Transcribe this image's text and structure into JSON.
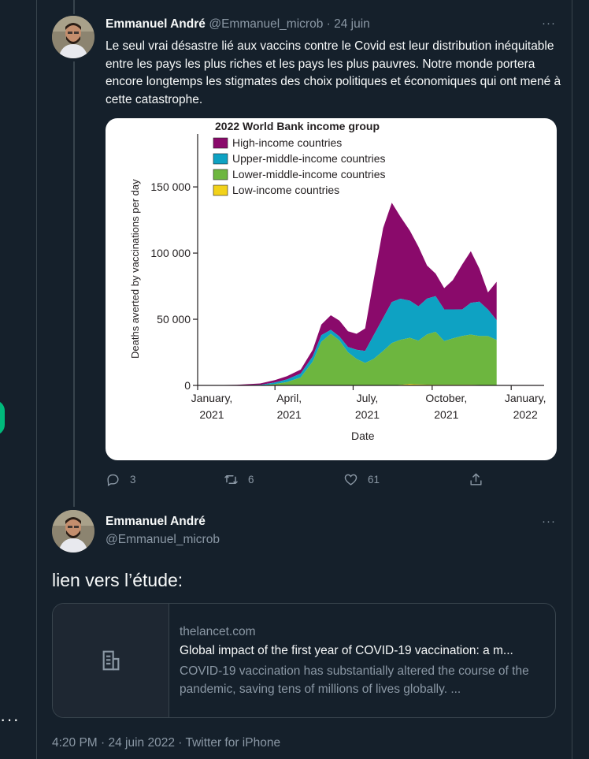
{
  "tweet1": {
    "author_name": "Emmanuel André",
    "author_handle": "@Emmanuel_microb",
    "date": "24 juin",
    "meta_separator": " · ",
    "text": "Le seul vrai désastre lié aux vaccins contre le Covid est leur distribution inéquitable entre les pays les plus riches et les pays les plus pauvres. Notre monde portera encore longtemps les stigmates des choix politiques et économiques qui ont mené à cette catastrophe.",
    "replies": "3",
    "retweets": "6",
    "likes": "61"
  },
  "chart_data": {
    "type": "area",
    "stacked": true,
    "legend_title": "2022 World Bank income group",
    "legend_position": "top-left",
    "xlabel": "Date",
    "ylabel": "Deaths averted by vaccinations per day",
    "x_ticks": [
      "January,\n2021",
      "April,\n2021",
      "July,\n2021",
      "October,\n2021",
      "January,\n2022"
    ],
    "y_ticks": [
      "0",
      "50 000",
      "100 000",
      "150 000"
    ],
    "ylim": [
      0,
      190000
    ],
    "x": [
      "2021-01-01",
      "2021-02-15",
      "2021-03-15",
      "2021-04-01",
      "2021-04-15",
      "2021-05-01",
      "2021-05-15",
      "2021-05-25",
      "2021-06-05",
      "2021-06-15",
      "2021-06-25",
      "2021-07-05",
      "2021-07-15",
      "2021-07-25",
      "2021-08-05",
      "2021-08-15",
      "2021-08-25",
      "2021-09-05",
      "2021-09-15",
      "2021-09-25",
      "2021-10-05",
      "2021-10-15",
      "2021-10-25",
      "2021-11-05",
      "2021-11-15",
      "2021-11-25",
      "2021-12-05",
      "2021-12-15"
    ],
    "series": [
      {
        "name": "Low-income countries",
        "color": "#f2d21a",
        "values": [
          0,
          0,
          0,
          0,
          0,
          0,
          0,
          0,
          0,
          0,
          0,
          0,
          0,
          0,
          0,
          0,
          500,
          1000,
          800,
          600,
          500,
          500,
          500,
          400,
          400,
          300,
          300,
          300
        ]
      },
      {
        "name": "Lower-middle-income countries",
        "color": "#6db63f",
        "values": [
          0,
          0,
          0,
          1000,
          2500,
          6000,
          18000,
          33000,
          39000,
          34000,
          25000,
          20000,
          17000,
          20000,
          26000,
          32000,
          34000,
          35000,
          33000,
          38000,
          40000,
          33000,
          35000,
          37000,
          38000,
          37000,
          37000,
          34000
        ]
      },
      {
        "name": "Upper-middle-income countries",
        "color": "#0ea2c3",
        "values": [
          0,
          100,
          500,
          1200,
          2000,
          3000,
          4000,
          5000,
          3000,
          3000,
          4000,
          7000,
          9000,
          18000,
          25000,
          31000,
          31000,
          28000,
          26000,
          27000,
          27000,
          24000,
          22000,
          20000,
          24000,
          26000,
          20000,
          15000
        ]
      },
      {
        "name": "High-income countries",
        "color": "#8a0a6b",
        "values": [
          0,
          300,
          1000,
          1800,
          2500,
          3000,
          5000,
          8000,
          11000,
          12000,
          12000,
          12000,
          17000,
          42000,
          68000,
          75000,
          62000,
          53000,
          45000,
          25000,
          17000,
          16000,
          22000,
          34000,
          39000,
          25000,
          13000,
          29000
        ]
      }
    ]
  },
  "tweet2": {
    "author_name": "Emmanuel André",
    "author_handle": "@Emmanuel_microb",
    "text": "lien vers l’étude:",
    "card": {
      "domain": "thelancet.com",
      "title": "Global impact of the first year of COVID-19 vaccination: a m...",
      "description": "COVID-19 vaccination has substantially altered the course of the pandemic, saving tens of millions of lives globally. ...",
      "thumb_icon": "document-icon"
    },
    "timestamp": "4:20 PM · 24 juin 2022 · Twitter for iPhone"
  },
  "sidebar": {
    "more_label": "···"
  },
  "more_label": "···",
  "colors": {
    "background": "#15202b",
    "border": "#38444d",
    "secondary_text": "#8b98a5",
    "accent_green": "#00ba7c"
  }
}
